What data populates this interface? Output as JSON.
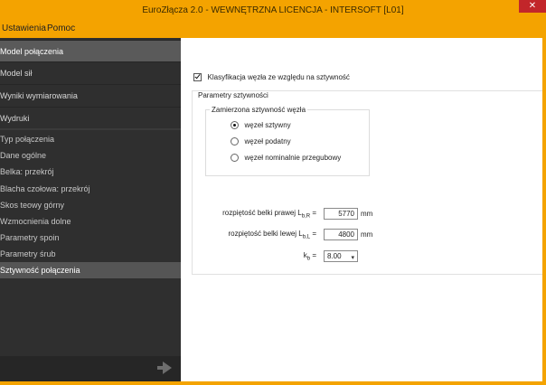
{
  "window": {
    "title": "EuroZłącza 2.0 - WEWNĘTRZNA LICENCJA - INTERSOFT [L01]",
    "close_label": "✕"
  },
  "menu": {
    "items": [
      "Ustawienia",
      "Pomoc"
    ]
  },
  "sidebar": {
    "main_items": [
      {
        "label": "Model połączenia",
        "active": true
      },
      {
        "label": "Model sił",
        "active": false
      },
      {
        "label": "Wyniki wymiarowania",
        "active": false
      },
      {
        "label": "Wydruki",
        "active": false
      }
    ],
    "sub_items": [
      {
        "label": "Typ połączenia",
        "active": false
      },
      {
        "label": "Dane ogólne",
        "active": false
      },
      {
        "label": "Belka: przekrój",
        "active": false
      },
      {
        "label": "Blacha czołowa: przekrój",
        "active": false
      },
      {
        "label": "Skos teowy górny",
        "active": false
      },
      {
        "label": "Wzmocnienia dolne",
        "active": false
      },
      {
        "label": "Parametry spoin",
        "active": false
      },
      {
        "label": "Parametry śrub",
        "active": false
      },
      {
        "label": "Sztywność połączenia",
        "active": true
      }
    ],
    "next_icon": "arrow-right-icon"
  },
  "content": {
    "classification_checkbox": {
      "label": "Klasyfikacja węzła ze względu na sztywność",
      "checked": true
    },
    "stiffness_group": {
      "legend": "Parametry sztywności",
      "assumed_group": {
        "legend": "Zamierzona sztywność węzła",
        "options": [
          {
            "label": "węzeł sztywny",
            "selected": true
          },
          {
            "label": "węzeł podatny",
            "selected": false
          },
          {
            "label": "węzeł nominalnie przegubowy",
            "selected": false
          }
        ]
      },
      "params": [
        {
          "label_main": "rozpiętość belki prawej L",
          "label_sub": "b,R",
          "eq": "=",
          "value": "5770",
          "unit": "mm"
        },
        {
          "label_main": "rozpiętość belki lewej L",
          "label_sub": "b,L",
          "eq": "=",
          "value": "4800",
          "unit": "mm"
        }
      ],
      "kb": {
        "label_main": "k",
        "label_sub": "b",
        "eq": "=",
        "value": "8.00"
      }
    }
  }
}
